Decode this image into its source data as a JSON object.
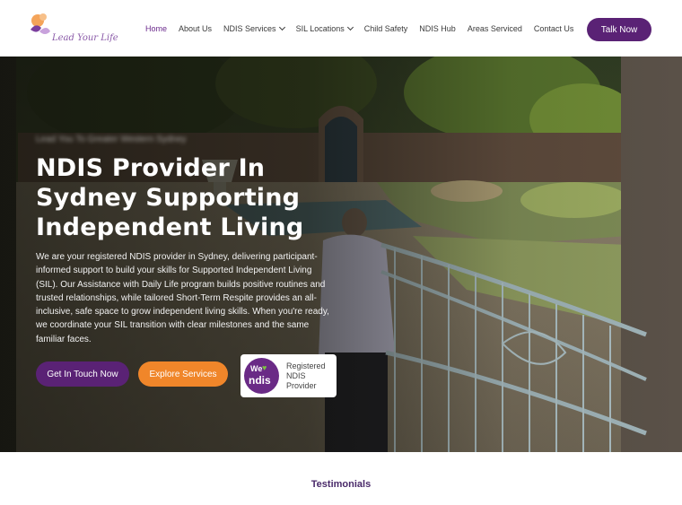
{
  "brand": {
    "logo_text": "Lead Your Life",
    "colors": {
      "purple": "#5a2275",
      "orange": "#f0862a",
      "nav_active": "#6b2a8c"
    }
  },
  "nav": {
    "items": [
      {
        "label": "Home",
        "active": true,
        "dropdown": false
      },
      {
        "label": "About Us",
        "active": false,
        "dropdown": false
      },
      {
        "label": "NDIS Services",
        "active": false,
        "dropdown": true
      },
      {
        "label": "SIL Locations",
        "active": false,
        "dropdown": true
      },
      {
        "label": "Child Safety",
        "active": false,
        "dropdown": false
      },
      {
        "label": "NDIS Hub",
        "active": false,
        "dropdown": false
      },
      {
        "label": "Areas Serviced",
        "active": false,
        "dropdown": false
      },
      {
        "label": "Contact Us",
        "active": false,
        "dropdown": false
      }
    ],
    "cta_label": "Talk Now"
  },
  "hero": {
    "eyebrow": "Lead You To Greater Western Sydney",
    "title": "NDIS Provider In Sydney Supporting Independent Living",
    "description": "We are your registered NDIS provider in Sydney, delivering participant-informed support to build your skills for Supported Independent Living (SIL). Our Assistance with Daily Life program builds positive routines and trusted relationships, while tailored Short-Term Respite provides an all-inclusive, safe space to grow independent living skills. When you're ready, we coordinate your SIL transition with clear milestones and the same familiar faces.",
    "primary_button": "Get In Touch Now",
    "secondary_button": "Explore Services",
    "badge": {
      "we": "We",
      "ndis": "ndis",
      "line1": "Registered",
      "line2": "NDIS Provider"
    }
  },
  "section": {
    "testimonials_label": "Testimonials"
  }
}
